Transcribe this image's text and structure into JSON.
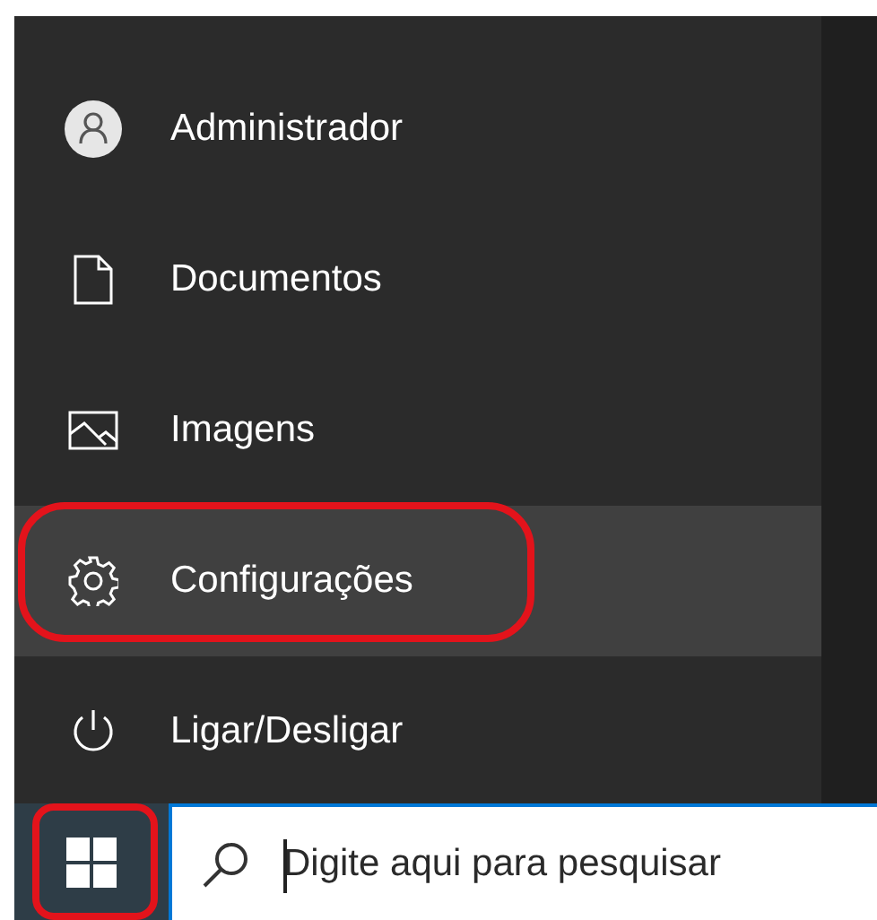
{
  "start_menu": {
    "items": [
      {
        "kind": "user",
        "label": "Administrador",
        "selected": false,
        "circled": false
      },
      {
        "kind": "documents",
        "label": "Documentos",
        "selected": false,
        "circled": false
      },
      {
        "kind": "pictures",
        "label": "Imagens",
        "selected": false,
        "circled": false
      },
      {
        "kind": "settings",
        "label": "Configurações",
        "selected": true,
        "circled": true
      },
      {
        "kind": "power",
        "label": "Ligar/Desligar",
        "selected": false,
        "circled": false
      }
    ]
  },
  "taskbar": {
    "start_button": {
      "circled": true
    },
    "search": {
      "placeholder": "Digite aqui para pesquisar"
    }
  }
}
